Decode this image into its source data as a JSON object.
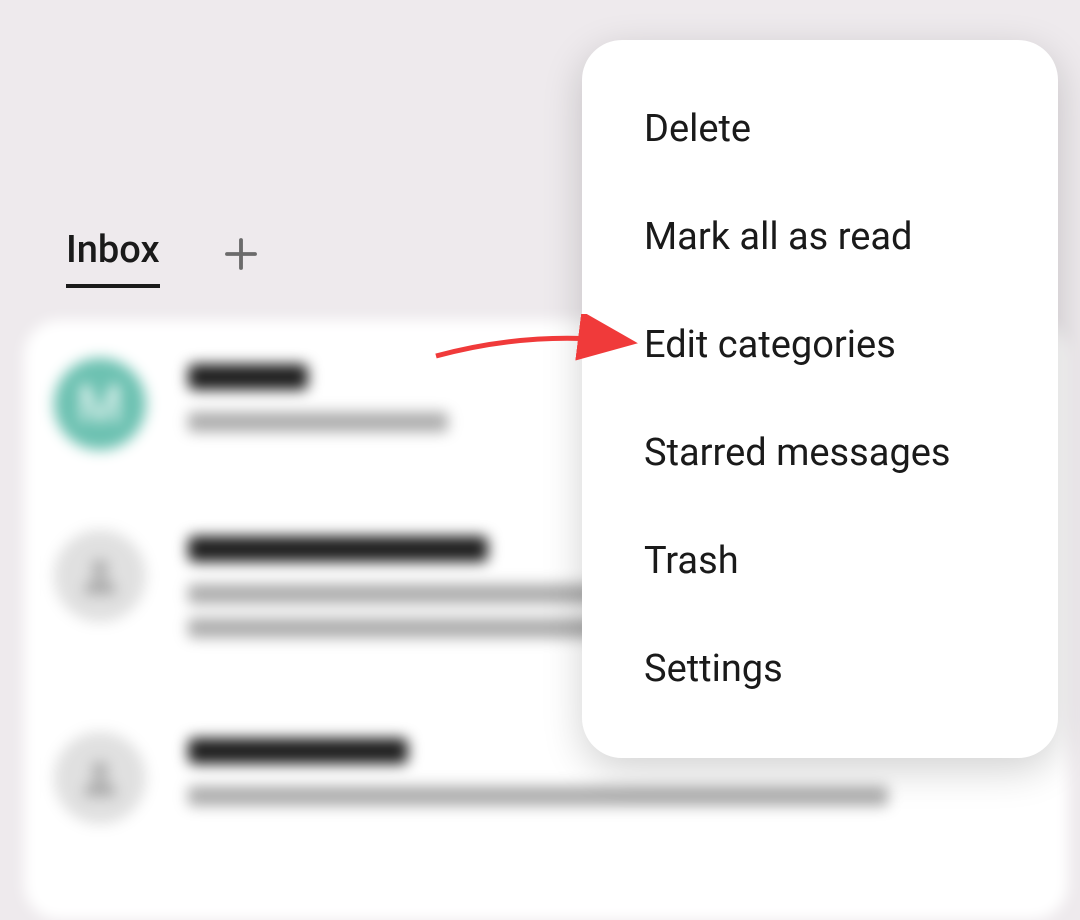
{
  "tabs": {
    "active_label": "Inbox"
  },
  "avatars": {
    "first_letter": "M"
  },
  "menu": {
    "items": [
      {
        "label": "Delete"
      },
      {
        "label": "Mark all as read"
      },
      {
        "label": "Edit categories"
      },
      {
        "label": "Starred messages"
      },
      {
        "label": "Trash"
      },
      {
        "label": "Settings"
      }
    ]
  },
  "annotation": {
    "arrow_color": "#f03a3a",
    "target_index": 2
  }
}
